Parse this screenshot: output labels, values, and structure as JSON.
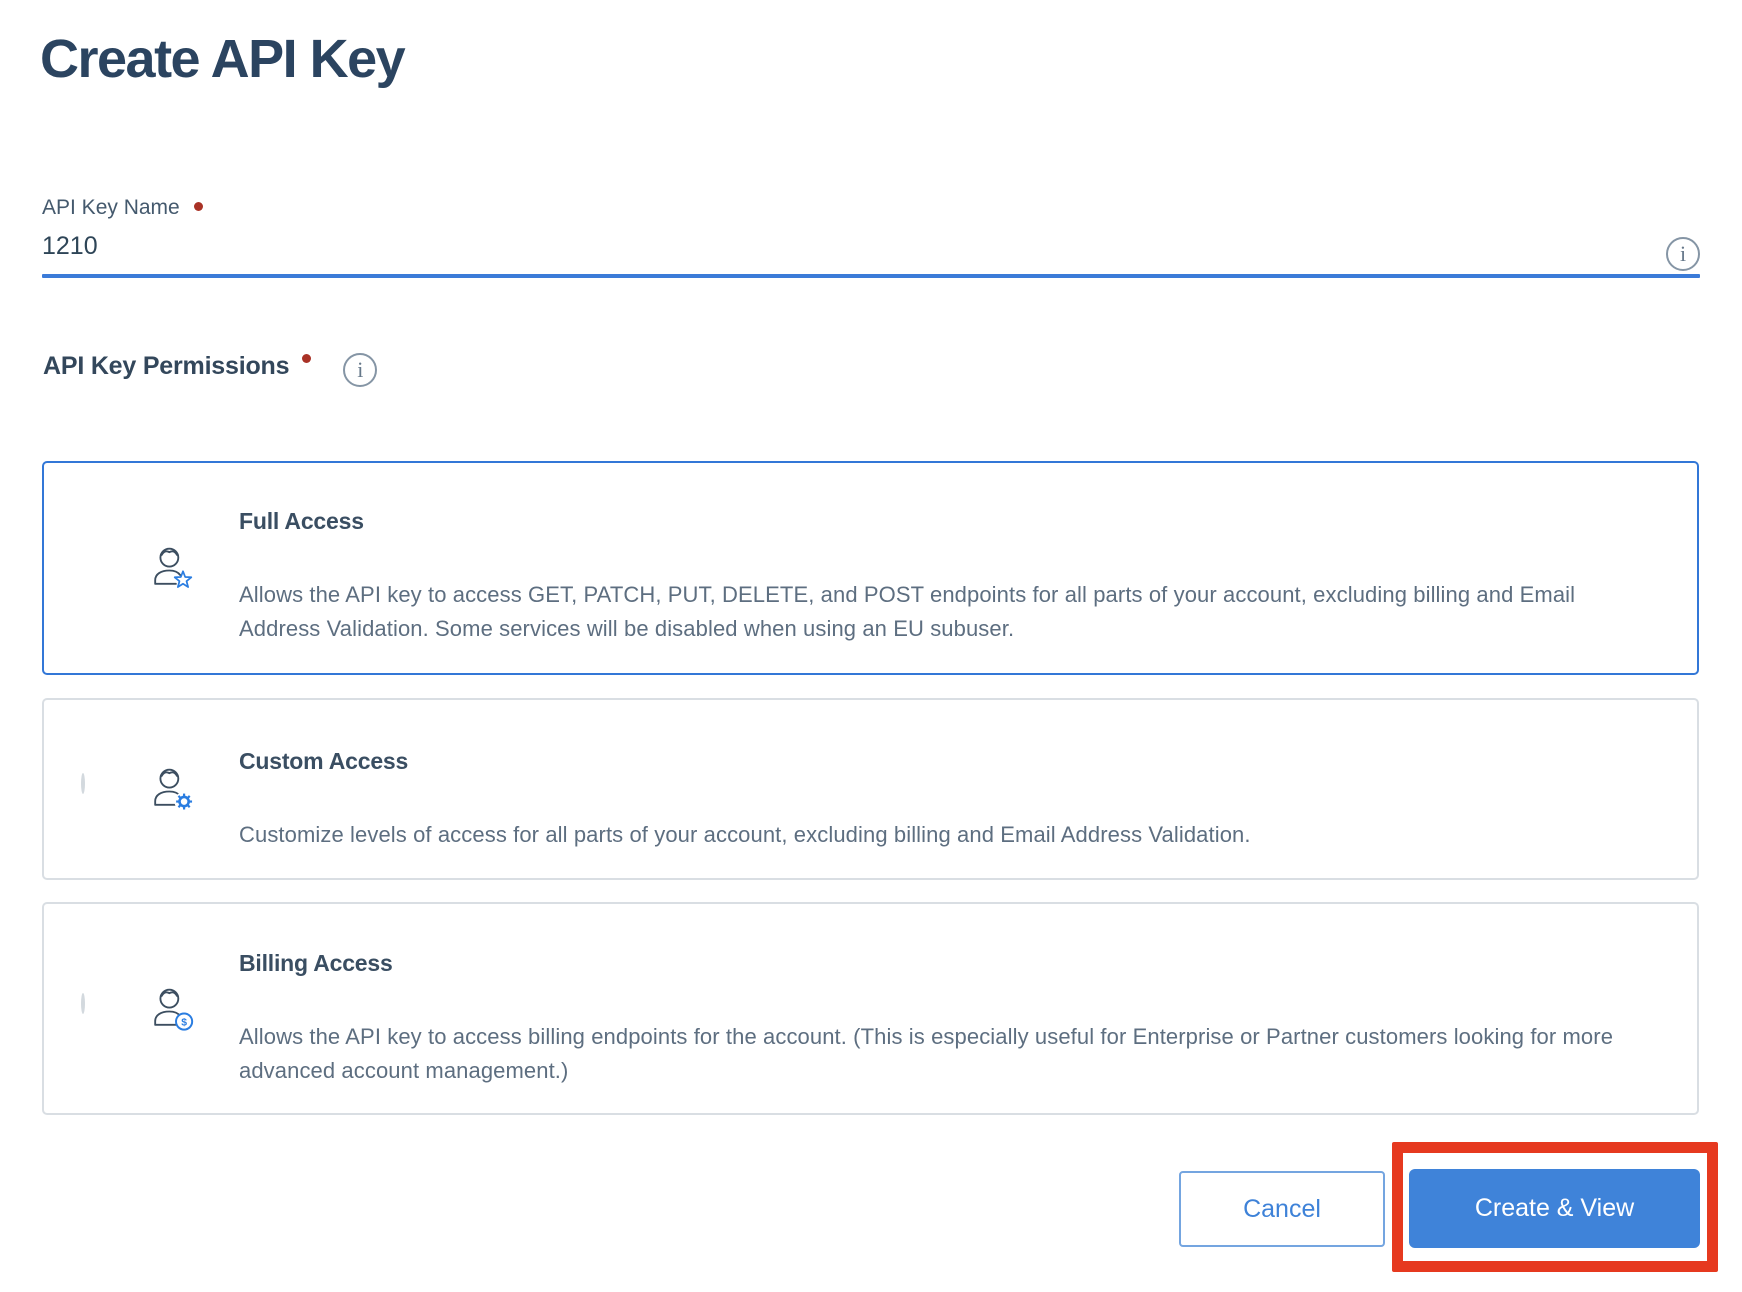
{
  "page": {
    "title": "Create API Key"
  },
  "api_key_name": {
    "label": "API Key Name",
    "required": true,
    "value": "1210",
    "info_icon": "i"
  },
  "permissions": {
    "label": "API Key Permissions",
    "required": true,
    "info_icon": "i",
    "options": [
      {
        "title": "Full Access",
        "description": "Allows the API key to access GET, PATCH, PUT, DELETE, and POST endpoints for all parts of your account, excluding billing and Email Address Validation. Some services will be disabled when using an EU subuser.",
        "selected": true,
        "icon": "user-star-icon"
      },
      {
        "title": "Custom Access",
        "description": "Customize levels of access for all parts of your account, excluding billing and Email Address Validation.",
        "selected": false,
        "icon": "user-gear-icon"
      },
      {
        "title": "Billing Access",
        "description": "Allows the API key to access billing endpoints for the account. (This is especially useful for Enterprise or Partner customers looking for more advanced account management.)",
        "selected": false,
        "icon": "user-dollar-icon"
      }
    ]
  },
  "actions": {
    "cancel": "Cancel",
    "create": "Create & View"
  },
  "annotation": {
    "type": "highlight-box",
    "target": "create-button",
    "color": "#e6391f"
  },
  "colors": {
    "title_navy": "#2b4460",
    "body_text": "#5d6e80",
    "accent_blue": "#3b7bd8",
    "selected_card_border": "#3277d7",
    "radio_selected": "#3b7de0",
    "badge_blue": "#2a7de1",
    "required_dot": "#a93226",
    "button_fill": "#3f83d9",
    "annotation_red": "#e6391f"
  }
}
